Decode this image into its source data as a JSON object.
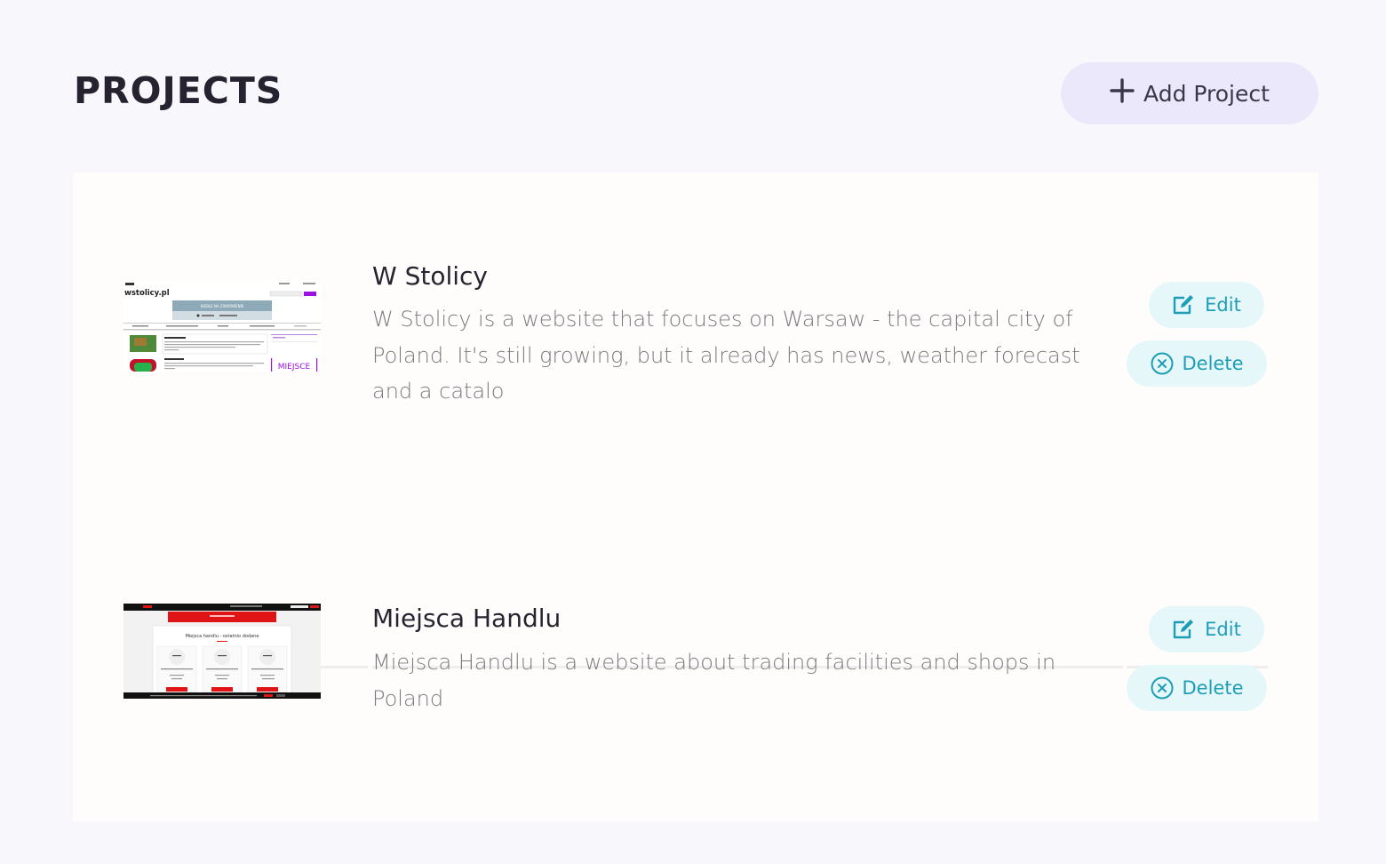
{
  "header": {
    "title": "PROJECTS",
    "add_button": {
      "icon": "plus-icon",
      "label": "Add Project"
    }
  },
  "projects": [
    {
      "title": "W Stolicy",
      "description": "W Stolicy is a website that focuses on Warsaw - the capital city of Poland. It's still growing, but it already has news, weather forecast and a catalo",
      "thumbnail": {
        "logo": "wstolicy.pl",
        "banner": "WEBLE NA ZAMÓWIENIE",
        "badge": "MIEJSCE"
      },
      "edit_label": "Edit",
      "delete_label": "Delete"
    },
    {
      "title": "Miejsca Handlu",
      "description": "Miejsca Handlu is a website about trading facilities and shops in Poland",
      "thumbnail": {
        "heading": "Miejsca handlu - ostatnio dodane"
      },
      "edit_label": "Edit",
      "delete_label": "Delete"
    }
  ],
  "colors": {
    "page_bg": "#f8f8fc",
    "panel_bg": "#fefdfb",
    "accent_add": "#ece8fb",
    "action_bg": "#e6f7fa",
    "action_text": "#1e9db6",
    "brand_purple": "#9b12e0",
    "brand_red": "#e01414"
  }
}
